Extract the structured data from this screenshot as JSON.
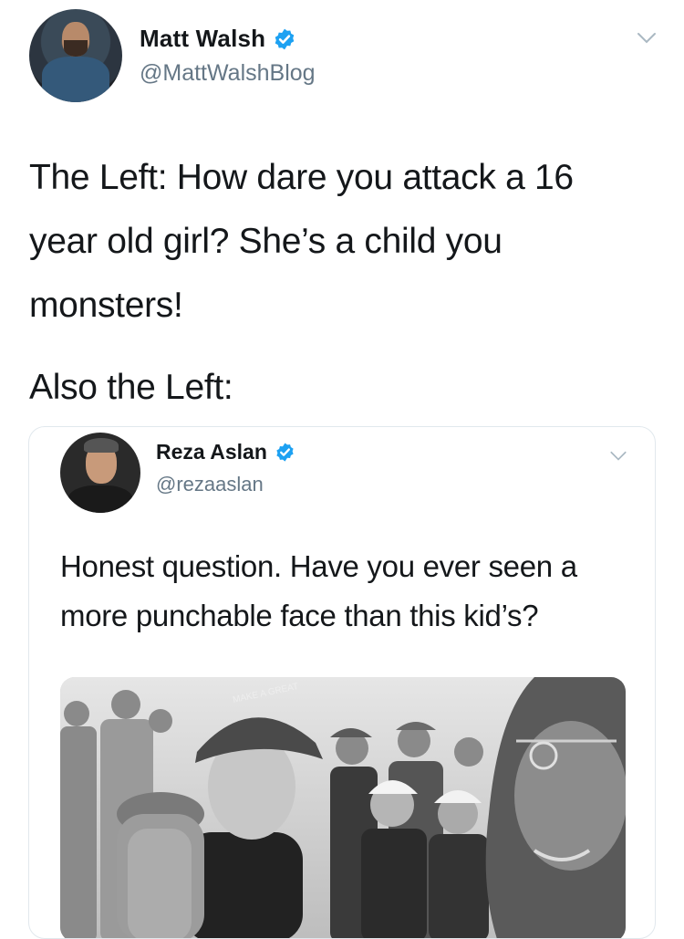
{
  "tweet": {
    "author": {
      "display_name": "Matt Walsh",
      "handle": "@MattWalshBlog",
      "verified": true
    },
    "lines": [
      "The Left: How dare you attack a 16",
      "year old girl? She’s a child you",
      "monsters!",
      "Also the Left:"
    ],
    "menu_icon": "chevron-down-icon"
  },
  "quoted_tweet": {
    "author": {
      "display_name": "Reza Aslan",
      "handle": "@rezaaslan",
      "verified": true
    },
    "lines": [
      "Honest question. Have you ever seen a",
      "more punchable face than this kid’s?"
    ],
    "media": {
      "type": "photo",
      "cap_text": "MAKE A GREAT"
    },
    "menu_icon": "chevron-down-icon"
  },
  "colors": {
    "verified_blue": "#1da1f2",
    "secondary_text": "#657786",
    "border": "#e1e8ed"
  }
}
